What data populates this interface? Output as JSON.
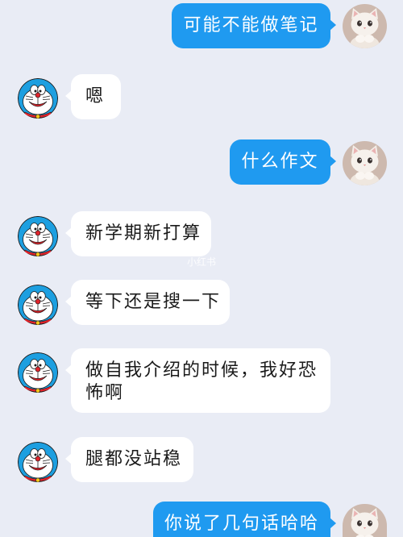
{
  "watermark": "小红书",
  "colors": {
    "background": "#e9ecf5",
    "outgoing_bubble": "#1f9af0",
    "outgoing_text": "#ffffff",
    "incoming_bubble": "#ffffff",
    "incoming_text": "#1a1a1a"
  },
  "messages": [
    {
      "side": "outgoing",
      "text": "可能不能做笔记",
      "avatar_icon": "cat-avatar"
    },
    {
      "side": "incoming",
      "text": "嗯",
      "avatar_icon": "doraemon-avatar"
    },
    {
      "side": "outgoing",
      "text": "什么作文",
      "avatar_icon": "cat-avatar"
    },
    {
      "side": "incoming",
      "text": "新学期新打算",
      "avatar_icon": "doraemon-avatar"
    },
    {
      "side": "incoming",
      "text": "等下还是搜一下",
      "avatar_icon": "doraemon-avatar"
    },
    {
      "side": "incoming",
      "text": "做自我介绍的时候，我好恐怖啊",
      "avatar_icon": "doraemon-avatar"
    },
    {
      "side": "incoming",
      "text": "腿都没站稳",
      "avatar_icon": "doraemon-avatar"
    },
    {
      "side": "outgoing",
      "text": "你说了几句话哈哈",
      "avatar_icon": "cat-avatar"
    }
  ]
}
